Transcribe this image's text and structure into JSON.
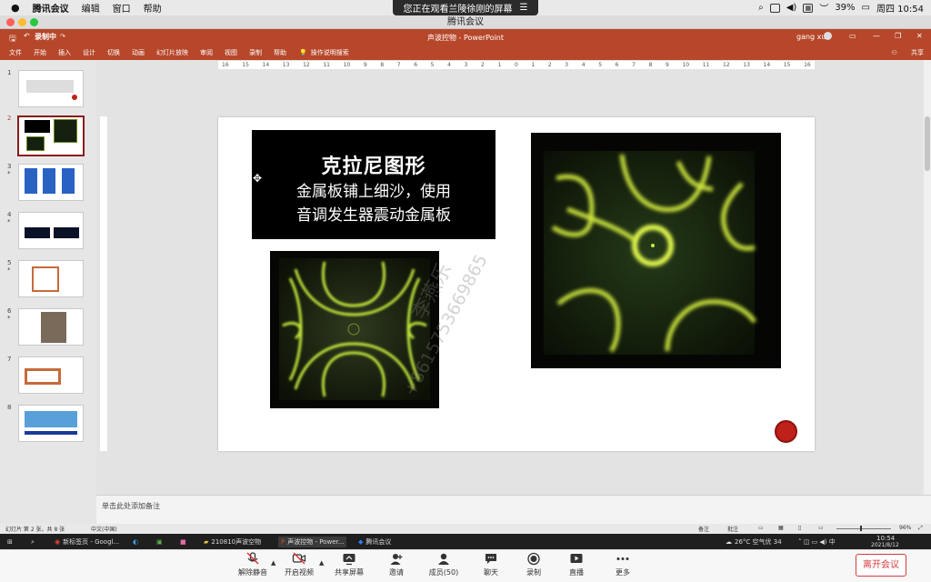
{
  "mac_menubar": {
    "app_name": "腾讯会议",
    "menus": [
      "编辑",
      "窗口",
      "帮助"
    ],
    "sharing_banner": "您正在观看兰陵徐刚的屏幕",
    "battery": "39%",
    "clock": "周四 10:54"
  },
  "meeting_window": {
    "title": "腾讯会议"
  },
  "ppt": {
    "recording_label": "录制中",
    "doc_title": "声波控物 - PowerPoint",
    "user": "gang xu",
    "share_label": "共享",
    "ribbon_tabs": [
      "文件",
      "开始",
      "插入",
      "设计",
      "切换",
      "动画",
      "幻灯片放映",
      "审阅",
      "视图",
      "录制",
      "帮助"
    ],
    "search_label": "操作说明搜索",
    "ruler_h": [
      "16",
      "15",
      "14",
      "13",
      "12",
      "11",
      "10",
      "9",
      "8",
      "7",
      "6",
      "5",
      "4",
      "3",
      "2",
      "1",
      "0",
      "1",
      "2",
      "3",
      "4",
      "5",
      "6",
      "7",
      "8",
      "9",
      "10",
      "11",
      "12",
      "13",
      "14",
      "15",
      "16"
    ],
    "slide_numbers": [
      "1",
      "2",
      "3",
      "4",
      "5",
      "6",
      "7",
      "8"
    ],
    "notes_placeholder": "单击此处添加备注",
    "status": {
      "slide_info": "幻灯片 第 2 张，共 8 张",
      "language": "中文(中国)",
      "notes_btn": "备注",
      "comments_btn": "批注",
      "zoom": "96%"
    }
  },
  "slide": {
    "title": "克拉尼图形",
    "subtitle_line1": "金属板铺上细沙，使用",
    "subtitle_line2": "音调发生器震动金属板",
    "watermark_name": "李燕乐",
    "watermark_phone": "+8615753669865"
  },
  "taskbar": {
    "items": [
      "新标签页 - Googl...",
      "210810声波空物",
      "声波控物 - Power...",
      "腾讯会议"
    ],
    "weather": "26°C 空气优 34",
    "time": "10:54",
    "date": "2021/8/12"
  },
  "meeting_toolbar": {
    "unmute": "解除静音",
    "video": "开启视频",
    "share": "共享屏幕",
    "invite": "邀请",
    "members": "成员(50)",
    "chat": "聊天",
    "record": "录制",
    "live": "直播",
    "more": "更多",
    "leave": "离开会议"
  },
  "colors": {
    "ppt_red": "#b7472a",
    "chladni_green": "#c8f03c",
    "leave_red": "#d43c3c"
  }
}
